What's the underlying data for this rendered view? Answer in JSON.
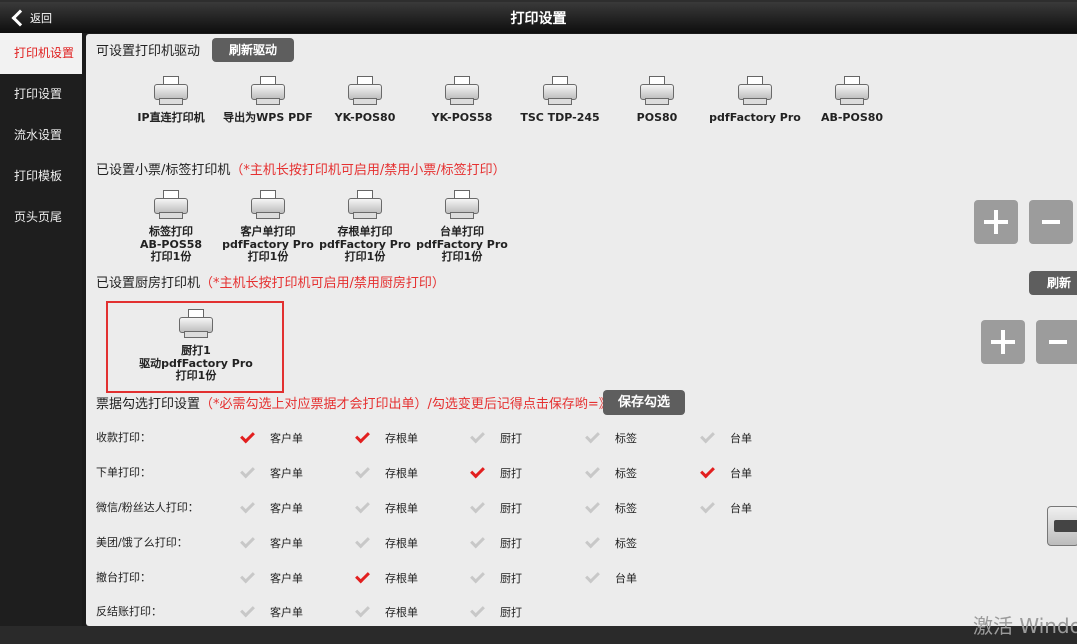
{
  "header": {
    "back_label": "返回",
    "title": "打印设置"
  },
  "sidebar": {
    "items": [
      {
        "label": "打印机设置",
        "active": true
      },
      {
        "label": "打印设置"
      },
      {
        "label": "流水设置"
      },
      {
        "label": "打印模板"
      },
      {
        "label": "页头页尾"
      }
    ]
  },
  "drivers": {
    "section_title": "可设置打印机驱动",
    "refresh_label": "刷新驱动",
    "items": [
      "IP直连打印机",
      "导出为WPS PDF",
      "YK-POS80",
      "YK-POS58",
      "TSC TDP-245",
      "POS80",
      "pdfFactory Pro",
      "AB-POS80"
    ]
  },
  "receipt_printers": {
    "section_title": "已设置小票/标签打印机",
    "note": "（*主机长按打印机可启用/禁用小票/标签打印）",
    "items": [
      {
        "name": "标签打印",
        "driver": "AB-POS58",
        "copies": "打印1份"
      },
      {
        "name": "客户单打印",
        "driver": "pdfFactory Pro",
        "copies": "打印1份"
      },
      {
        "name": "存根单打印",
        "driver": "pdfFactory Pro",
        "copies": "打印1份"
      },
      {
        "name": "台单打印",
        "driver": "pdfFactory Pro",
        "copies": "打印1份"
      }
    ]
  },
  "kitchen_printers": {
    "section_title": "已设置厨房打印机",
    "note": "（*主机长按打印机可启用/禁用厨房打印）",
    "refresh_label": "刷新",
    "items": [
      {
        "name": "厨打1",
        "driver": "驱动pdfFactory Pro",
        "copies": "打印1份"
      }
    ]
  },
  "ticket_settings": {
    "section_title": "票据勾选打印设置",
    "note": "（*必需勾选上对应票据才会打印出单）/勾选变更后记得点击保存哟=》",
    "save_label": "保存勾选",
    "rows": [
      {
        "label": "收款打印：",
        "options": [
          {
            "label": "客户单",
            "checked": true
          },
          {
            "label": "存根单",
            "checked": true
          },
          {
            "label": "厨打",
            "checked": false
          },
          {
            "label": "标签",
            "checked": false
          },
          {
            "label": "台单",
            "checked": false
          }
        ]
      },
      {
        "label": "下单打印：",
        "options": [
          {
            "label": "客户单",
            "checked": false
          },
          {
            "label": "存根单",
            "checked": false
          },
          {
            "label": "厨打",
            "checked": true
          },
          {
            "label": "标签",
            "checked": false
          },
          {
            "label": "台单",
            "checked": true
          }
        ]
      },
      {
        "label": "微信/粉丝达人打印：",
        "options": [
          {
            "label": "客户单",
            "checked": false
          },
          {
            "label": "存根单",
            "checked": false
          },
          {
            "label": "厨打",
            "checked": false
          },
          {
            "label": "标签",
            "checked": false
          },
          {
            "label": "台单",
            "checked": false
          }
        ]
      },
      {
        "label": "美团/饿了么打印：",
        "options": [
          {
            "label": "客户单",
            "checked": false
          },
          {
            "label": "存根单",
            "checked": false
          },
          {
            "label": "厨打",
            "checked": false
          },
          {
            "label": "标签",
            "checked": false
          }
        ]
      },
      {
        "label": "撤台打印：",
        "options": [
          {
            "label": "客户单",
            "checked": false
          },
          {
            "label": "存根单",
            "checked": true
          },
          {
            "label": "厨打",
            "checked": false
          },
          {
            "label": "台单",
            "checked": false
          }
        ]
      },
      {
        "label": "反结账打印：",
        "options": [
          {
            "label": "客户单",
            "checked": false
          },
          {
            "label": "存根单",
            "checked": false
          },
          {
            "label": "厨打",
            "checked": false
          }
        ]
      }
    ]
  },
  "watermark": "激活 Windo",
  "colors": {
    "accent": "#e53030",
    "sidebar_bg": "#1e1e1e",
    "panel_bg": "#ececec",
    "button_bg": "#5e5e5e"
  }
}
